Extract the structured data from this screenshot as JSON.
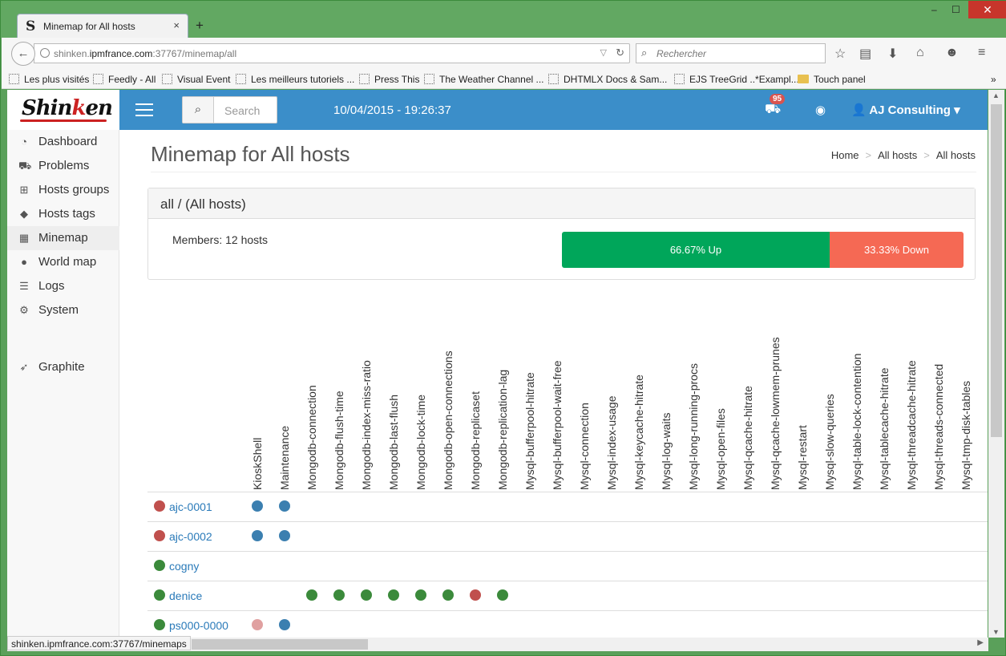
{
  "browser": {
    "tab_title": "Minemap for All hosts",
    "tab_favicon": "S",
    "close_tab": "×",
    "new_tab": "+",
    "url_host": "shinken.ipmfrance.com",
    "url_prefix": "shinken.",
    "url_domain": "ipmfrance.com",
    "url_rest": ":37767/minemap/all",
    "search_placeholder": "Rechercher",
    "bookmarks": [
      "Les plus visités",
      "Feedly - All",
      "Visual Event",
      "Les meilleurs tutoriels ...",
      "Press This",
      "The Weather Channel ...",
      "DHTMLX Docs & Sam...",
      "EJS TreeGrid ..*Exampl...",
      "Touch panel"
    ],
    "status_url": "shinken.ipmfrance.com:37767/minemaps",
    "window_min": "–",
    "window_max": "☐",
    "window_close": "✕"
  },
  "app": {
    "logo_text_a": "Shin",
    "logo_text_b": "k",
    "logo_text_c": "en",
    "search_placeholder": "Search",
    "datetime": "10/04/2015 - 19:26:37",
    "alert_count": "95",
    "user": "AJ Consulting",
    "user_caret": "▾"
  },
  "sidebar": {
    "items": [
      {
        "label": "Dashboard",
        "icon": "dashboard-icon"
      },
      {
        "label": "Problems",
        "icon": "ambulance-icon"
      },
      {
        "label": "Hosts groups",
        "icon": "sitemap-icon"
      },
      {
        "label": "Hosts tags",
        "icon": "tags-icon"
      },
      {
        "label": "Minemap",
        "icon": "table-icon",
        "active": true
      },
      {
        "label": "World map",
        "icon": "globe-icon"
      },
      {
        "label": "Logs",
        "icon": "list-icon"
      },
      {
        "label": "System",
        "icon": "gears-icon"
      },
      {
        "label": "Graphite",
        "icon": "rocket-icon"
      }
    ]
  },
  "page": {
    "title": "Minemap for All hosts",
    "breadcrumb": [
      "Home",
      "All hosts",
      "All hosts"
    ],
    "breadcrumb_sep": ">",
    "panel_title": "all / (All hosts)",
    "members": "Members: 12 hosts",
    "up_label": "66.67% Up",
    "up_fraction": 0.6667,
    "down_label": "33.33% Down"
  },
  "minemap": {
    "columns": [
      "KioskShell",
      "Maintenance",
      "Mongodb-connection",
      "Mongodb-flush-time",
      "Mongodb-index-miss-ratio",
      "Mongodb-last-flush",
      "Mongodb-lock-time",
      "Mongodb-open-connections",
      "Mongodb-replicaset",
      "Mongodb-replication-lag",
      "Mysql-bufferpool-hitrate",
      "Mysql-bufferpool-wait-free",
      "Mysql-connection",
      "Mysql-index-usage",
      "Mysql-keycache-hitrate",
      "Mysql-log-waits",
      "Mysql-long-running-procs",
      "Mysql-open-files",
      "Mysql-qcache-hitrate",
      "Mysql-qcache-lowmem-prunes",
      "Mysql-restart",
      "Mysql-slow-queries",
      "Mysql-table-lock-contention",
      "Mysql-tablecache-hitrate",
      "Mysql-threadcache-hitrate",
      "Mysql-threads-connected",
      "Mysql-tmp-disk-tables"
    ],
    "rows": [
      {
        "host": "ajc-0001",
        "status": "down",
        "cells": {
          "0": "info",
          "1": "info"
        }
      },
      {
        "host": "ajc-0002",
        "status": "down",
        "cells": {
          "0": "info",
          "1": "info"
        }
      },
      {
        "host": "cogny",
        "status": "up",
        "cells": {}
      },
      {
        "host": "denice",
        "status": "up",
        "cells": {
          "2": "ok",
          "3": "ok",
          "4": "ok",
          "5": "ok",
          "6": "ok",
          "7": "ok",
          "8": "critical",
          "9": "ok"
        }
      },
      {
        "host": "ps000-0000",
        "status": "up",
        "cells": {
          "0": "faded",
          "1": "info"
        }
      }
    ],
    "colors": {
      "up": "#3b8a3b",
      "down": "#c0504d",
      "ok": "#3b8a3b",
      "info": "#3b7fb0",
      "critical": "#c0504d",
      "faded": "#e0a0a0"
    }
  }
}
